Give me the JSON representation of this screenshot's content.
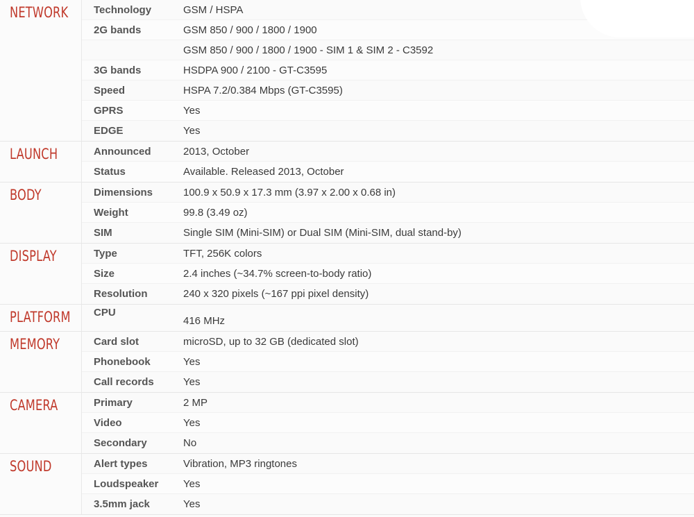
{
  "sheet": {
    "accent_color": "#c0392b",
    "label_color": "#555555",
    "value_color": "#3a3a3a",
    "sections": [
      {
        "category": "NETWORK",
        "rows": [
          {
            "label": "Technology",
            "value": "GSM / HSPA"
          },
          {
            "label": "2G bands",
            "value": "GSM 850 / 900 / 1800 / 1900"
          },
          {
            "label": "",
            "value": "GSM 850 / 900 / 1800 / 1900 - SIM 1 & SIM 2 - C3592"
          },
          {
            "label": "3G bands",
            "value": "HSDPA 900 / 2100 - GT-C3595"
          },
          {
            "label": "Speed",
            "value": "HSPA 7.2/0.384 Mbps (GT-C3595)"
          },
          {
            "label": "GPRS",
            "value": "Yes"
          },
          {
            "label": "EDGE",
            "value": "Yes"
          }
        ]
      },
      {
        "category": "LAUNCH",
        "rows": [
          {
            "label": "Announced",
            "value": "2013, October"
          },
          {
            "label": "Status",
            "value": "Available. Released 2013, October"
          }
        ]
      },
      {
        "category": "BODY",
        "rows": [
          {
            "label": "Dimensions",
            "value": "100.9 x 50.9 x 17.3 mm (3.97 x 2.00 x 0.68 in)"
          },
          {
            "label": "Weight",
            "value": "99.8 (3.49 oz)"
          },
          {
            "label": "SIM",
            "value": "Single SIM (Mini-SIM) or Dual SIM (Mini-SIM, dual stand-by)"
          }
        ]
      },
      {
        "category": "DISPLAY",
        "rows": [
          {
            "label": "Type",
            "value": "TFT, 256K colors"
          },
          {
            "label": "Size",
            "value": "2.4 inches (~34.7% screen-to-body ratio)"
          },
          {
            "label": "Resolution",
            "value": "240 x 320 pixels (~167 ppi pixel density)"
          }
        ]
      },
      {
        "category": "PLATFORM",
        "rows": [
          {
            "label": "CPU",
            "value": "416 MHz",
            "tall": true
          }
        ]
      },
      {
        "category": "MEMORY",
        "rows": [
          {
            "label": "Card slot",
            "value": "microSD, up to 32 GB (dedicated slot)"
          },
          {
            "label": "Phonebook",
            "value": "Yes"
          },
          {
            "label": "Call records",
            "value": "Yes"
          }
        ]
      },
      {
        "category": "CAMERA",
        "rows": [
          {
            "label": "Primary",
            "value": "2 MP"
          },
          {
            "label": "Video",
            "value": "Yes"
          },
          {
            "label": "Secondary",
            "value": "No"
          }
        ]
      },
      {
        "category": "SOUND",
        "rows": [
          {
            "label": "Alert types",
            "value": "Vibration, MP3 ringtones"
          },
          {
            "label": "Loudspeaker",
            "value": "Yes"
          },
          {
            "label": "3.5mm jack",
            "value": "Yes"
          }
        ]
      }
    ]
  }
}
